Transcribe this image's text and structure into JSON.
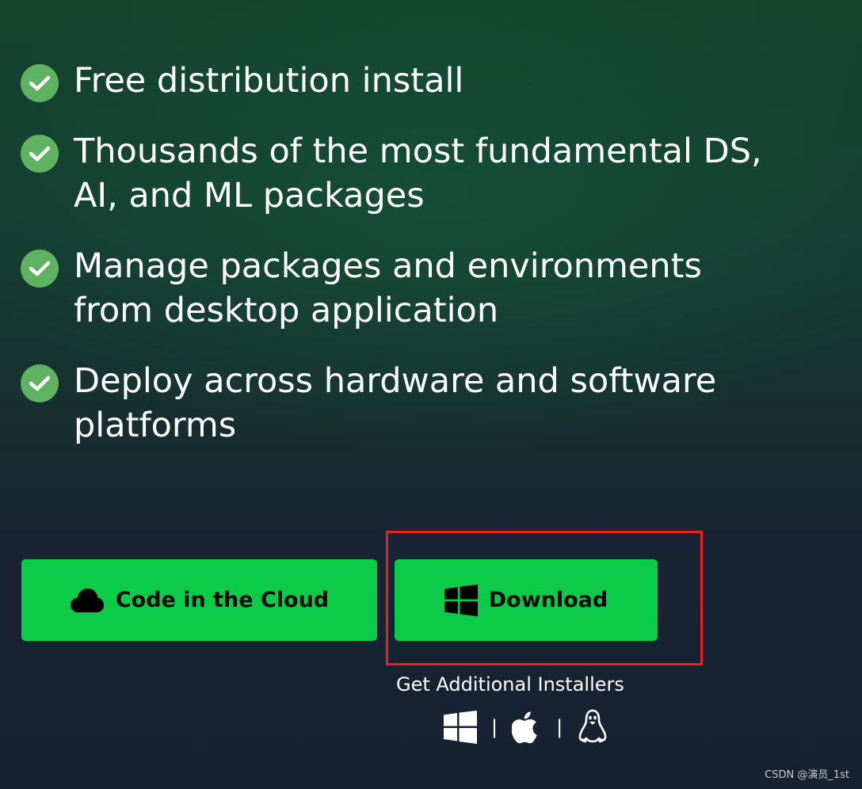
{
  "features": [
    {
      "text": "Free distribution install"
    },
    {
      "text": "Thousands of the most fundamental DS,\nAI, and ML packages"
    },
    {
      "text": "Manage packages and environments\nfrom desktop application"
    },
    {
      "text": "Deploy across hardware and software\nplatforms"
    }
  ],
  "buttons": {
    "cloud_label": "Code in the Cloud",
    "download_label": "Download"
  },
  "installers": {
    "label": "Get Additional Installers",
    "separator": "|",
    "icons": [
      "windows-icon",
      "apple-icon",
      "linux-icon"
    ]
  },
  "watermark": "CSDN @演员_1st",
  "colors": {
    "button_green": "#0ccb48",
    "check_green": "#5fb25f",
    "highlight_red": "#e8211f"
  }
}
